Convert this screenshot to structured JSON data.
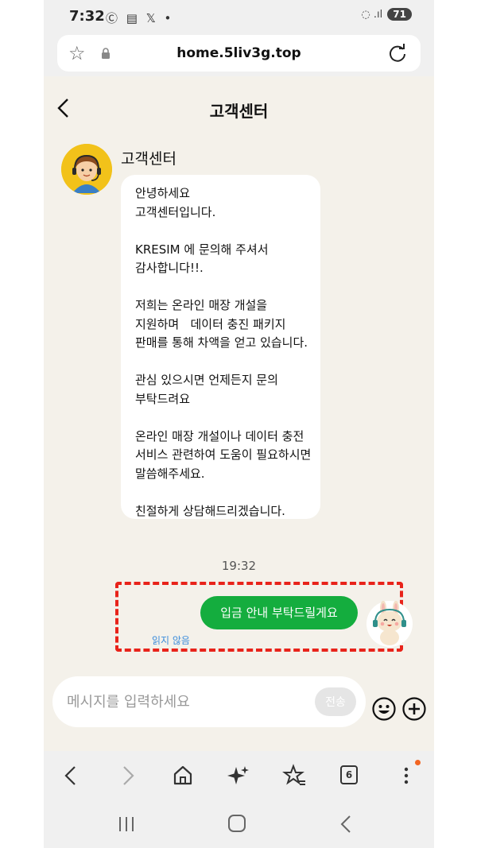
{
  "status_bar": {
    "time": "7:32",
    "notification_icons": "Ⓒ ▤ 𝕏 •",
    "signal_icons": "◌ .ıl",
    "battery": "71"
  },
  "browser": {
    "url": "home.5liv3g.top",
    "star_icon": "☆"
  },
  "chat": {
    "title": "고객센터",
    "agent_name": "고객센터",
    "agent_message": "안녕하세요\n고객센터입니다.\n\nKRESIM 에 문의해 주셔서 감사합니다!!.\n\n저희는 온라인 매장 개설을 지원하며   데이터 충진 패키지 판매를 통해 차액을 얻고 있습니다.\n\n관심 있으시면 언제든지 문의 부탁드려요\n\n온라인 매장 개설이나 데이터 충전 서비스 관련하여 도움이 필요하시면 말씀해주세요.\n\n친절하게 상담해드리겠습니다.",
    "timestamp": "19:32",
    "my_message": "입금 안내 부탁드릴게요",
    "read_status": "읽지 않음"
  },
  "input": {
    "placeholder": "메시지를 입력하세요",
    "value": "",
    "send_label": "전송"
  },
  "toolbar": {
    "tab_count": "6"
  },
  "colors": {
    "accent_green": "#14ad3e",
    "highlight_red": "#e8231a",
    "chat_bg": "#f4f1ea",
    "read_status_blue": "#3d8ddb"
  },
  "icons": [
    "star-icon",
    "lock-icon",
    "reload-icon",
    "back-arrow-icon",
    "smile-icon",
    "plus-circle-icon",
    "back-icon",
    "forward-icon",
    "home-icon",
    "sparkle-icon",
    "star-list-icon",
    "tabs-icon",
    "more-icon",
    "recents-icon",
    "nav-home-icon",
    "nav-back-icon"
  ]
}
